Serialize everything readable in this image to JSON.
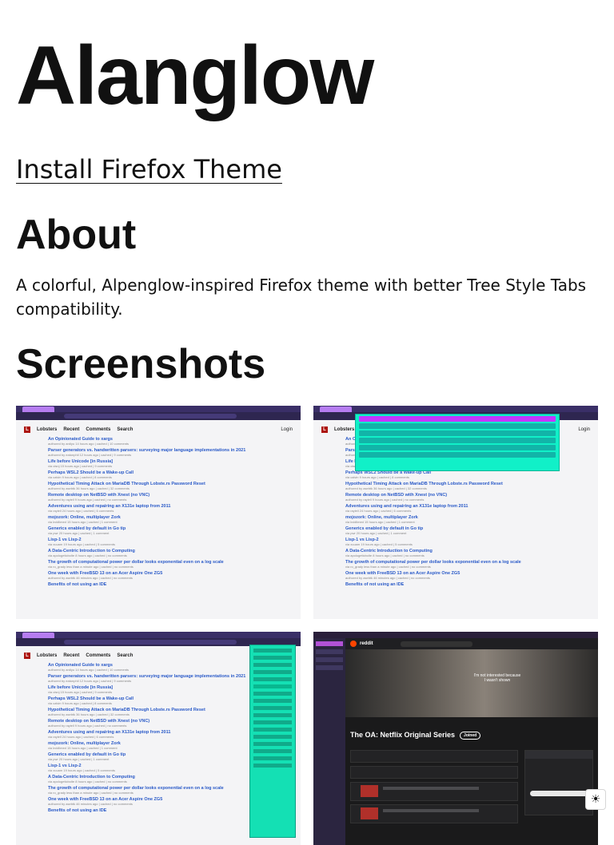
{
  "site": {
    "title": "Alanglow",
    "install_link": "Install Firefox Theme"
  },
  "about": {
    "heading": "About",
    "text": "A colorful, Alpenglow-inspired Firefox theme with better Tree Style Tabs compatibility."
  },
  "screenshots": {
    "heading": "Screenshots",
    "lobsters": {
      "brand": "Lobsters",
      "nav": [
        "Recent",
        "Comments",
        "Search"
      ],
      "login": "Login",
      "stories": [
        {
          "title": "An Opinionated Guide to xargs",
          "meta": "authored by ardiyu 14 hours ago | cached | 10 comments"
        },
        {
          "title": "Parser generators vs. handwritten parsers: surveying major language implementations in 2021",
          "meta": "authored by eatonphil 12 hours ago | cached | 9 comments"
        },
        {
          "title": "Life before Unicode [in Russia]",
          "meta": "via oisnj 15 hours ago | cached | 9 comments"
        },
        {
          "title": "Perhaps WSL2 Should be a Wake-up Call",
          "meta": "via calvin 9 hours ago | cached | 8 comments"
        },
        {
          "title": "Hypothetical Timing Attack on MariaDB Through Lobste.rs Password Reset",
          "meta": "authored by asebtk 36 hours ago | cached | 32 comments"
        },
        {
          "title": "Remote desktop on NetBSD with Xnest (no VNC)",
          "meta": "authored by rayiell 9 hours ago | cached | no comments"
        },
        {
          "title": "Adventures using and repairing an X131e laptop from 2011",
          "meta": "via rayiell 24 hours ago | cached | 6 comments"
        },
        {
          "title": "mojozork: Online, multiplayer Zork",
          "meta": "via kvidlimed 15 hours ago | cached | 1 comment"
        },
        {
          "title": "Generics enabled by default in Go tip",
          "meta": "via pwr 20 hours ago | cached | 1 comment"
        },
        {
          "title": "Lisp-1 vs Lisp-2",
          "meta": "via xuuam 19 hours ago | cached | 5 comments"
        },
        {
          "title": "A Data-Centric Introduction to Computing",
          "meta": "via apologeticbolte 8 hours ago | cached | no comments"
        },
        {
          "title": "The growth of computational power per dollar looks exponential even on a log scale",
          "meta": "via ro_grady less than a minute ago | cached | no comments"
        },
        {
          "title": "One week with FreeBSD 13 on an Acer Aspire One ZG5",
          "meta": "authored by asebtk 46 minutes ago | cached | no comments"
        },
        {
          "title": "Benefits of not using an IDE",
          "meta": ""
        }
      ],
      "tag": "tag"
    },
    "reddit": {
      "brand": "reddit",
      "banner_caption": "I'm not interested because I wasn't shown",
      "sub_title": "The OA: Netflix Original Series",
      "joined": "Joined"
    },
    "alts": [
      "Screenshot 1",
      "Screenshot 2",
      "Screenshot 3",
      "Screenshot 4"
    ]
  },
  "theme_toggle": {
    "icon": "sun-icon",
    "glyph": "☀"
  },
  "colors": {
    "accent_purple": "#b67df0",
    "accent_teal": "#11f0c8",
    "chrome_dark": "#2e2650",
    "link_blue": "#2a5ac8"
  }
}
